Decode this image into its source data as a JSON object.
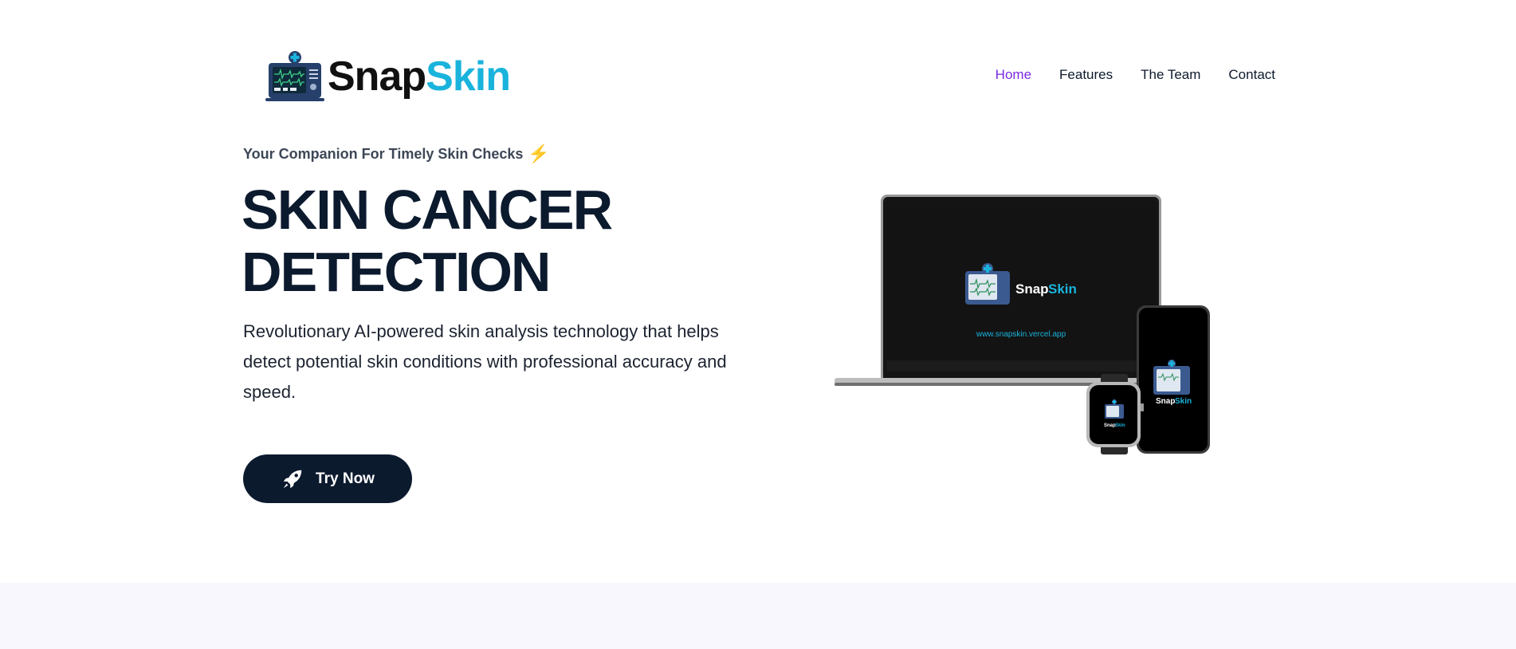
{
  "brand": {
    "name_part1": "Snap",
    "name_part2": "Skin",
    "color_dark": "#111111",
    "color_accent": "#1ab3dc",
    "logo_icon": "medical-monitor-icon"
  },
  "nav": {
    "items": [
      {
        "label": "Home",
        "active": true
      },
      {
        "label": "Features",
        "active": false
      },
      {
        "label": "The Team",
        "active": false
      },
      {
        "label": "Contact",
        "active": false
      }
    ],
    "active_color": "#7a2be0"
  },
  "hero": {
    "tagline": "Your Companion For Timely Skin Checks",
    "tagline_icon": "lightning-icon",
    "headline_line1": "SKIN CANCER",
    "headline_line2": "DETECTION",
    "description": "Revolutionary AI-powered skin analysis technology that helps detect potential skin conditions with professional accuracy and speed.",
    "cta_label": "Try Now",
    "cta_icon": "rocket-icon",
    "cta_color": "#0c1a2e"
  },
  "device_mockup": {
    "laptop_brand_part1": "Snap",
    "laptop_brand_part2": "Skin",
    "laptop_url": "www.snapskin.vercel.app",
    "phone_brand_part1": "Snap",
    "phone_brand_part2": "Skin",
    "watch_brand_part1": "Snap",
    "watch_brand_part2": "Skin"
  }
}
